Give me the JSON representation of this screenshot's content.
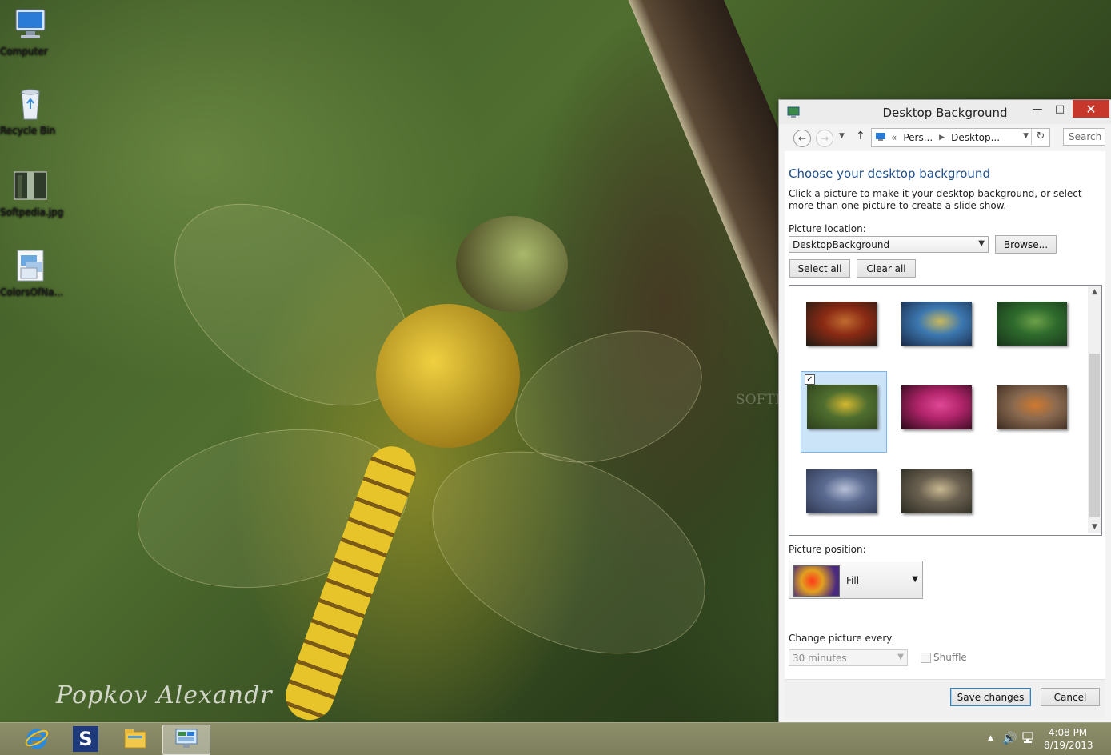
{
  "desktop": {
    "icons": [
      {
        "label": "Computer",
        "icon": "computer-icon"
      },
      {
        "label": "Recycle Bin",
        "icon": "recycle-bin-icon"
      },
      {
        "label": "Softpedia.jpg",
        "icon": "image-file-icon"
      },
      {
        "label": "ColorsOfNa...",
        "icon": "theme-file-icon"
      }
    ],
    "signature": "Popkov Alexandr",
    "watermark": "SOFTPEDIA"
  },
  "window": {
    "title": "Desktop Background",
    "breadcrumb": {
      "prefix": "«",
      "items": [
        "Pers...",
        "Desktop..."
      ]
    },
    "search_placeholder": "Search C",
    "heading": "Choose your desktop background",
    "description": "Click a picture to make it your desktop background, or select more than one picture to create a slide show.",
    "picture_location_label": "Picture location:",
    "picture_location_value": "DesktopBackground",
    "browse_label": "Browse...",
    "select_all_label": "Select all",
    "clear_all_label": "Clear all",
    "thumbnails": [
      {
        "name": "apple",
        "selected": false,
        "colors": [
          "#1e1b14",
          "#8a2a14",
          "#c06c30"
        ]
      },
      {
        "name": "bird",
        "selected": false,
        "colors": [
          "#1a2a4a",
          "#3c78b0",
          "#c8b860"
        ]
      },
      {
        "name": "green-leaves",
        "selected": false,
        "colors": [
          "#18331a",
          "#2e6a2c",
          "#6ca048"
        ]
      },
      {
        "name": "dragonfly",
        "selected": true,
        "colors": [
          "#2c3f1c",
          "#4f6e2f",
          "#d4b830"
        ]
      },
      {
        "name": "pink-flowers",
        "selected": false,
        "colors": [
          "#2a0a18",
          "#b0246a",
          "#e04896"
        ]
      },
      {
        "name": "hoopoe",
        "selected": false,
        "colors": [
          "#3a2a20",
          "#8a6a50",
          "#d07a30"
        ]
      },
      {
        "name": "pier",
        "selected": false,
        "colors": [
          "#303852",
          "#5a6a90",
          "#b8c0d8"
        ]
      },
      {
        "name": "owl",
        "selected": false,
        "colors": [
          "#2a2a20",
          "#6a6050",
          "#c8b890"
        ]
      }
    ],
    "picture_position_label": "Picture position:",
    "picture_position_value": "Fill",
    "change_every_label": "Change picture every:",
    "change_every_value": "30 minutes",
    "shuffle_label": "Shuffle",
    "save_label": "Save changes",
    "cancel_label": "Cancel"
  },
  "taskbar": {
    "apps": [
      "internet-explorer-icon",
      "softpedia-icon",
      "file-explorer-icon",
      "control-panel-icon"
    ],
    "softpedia_letter": "S",
    "time": "4:08 PM",
    "date": "8/19/2013"
  }
}
